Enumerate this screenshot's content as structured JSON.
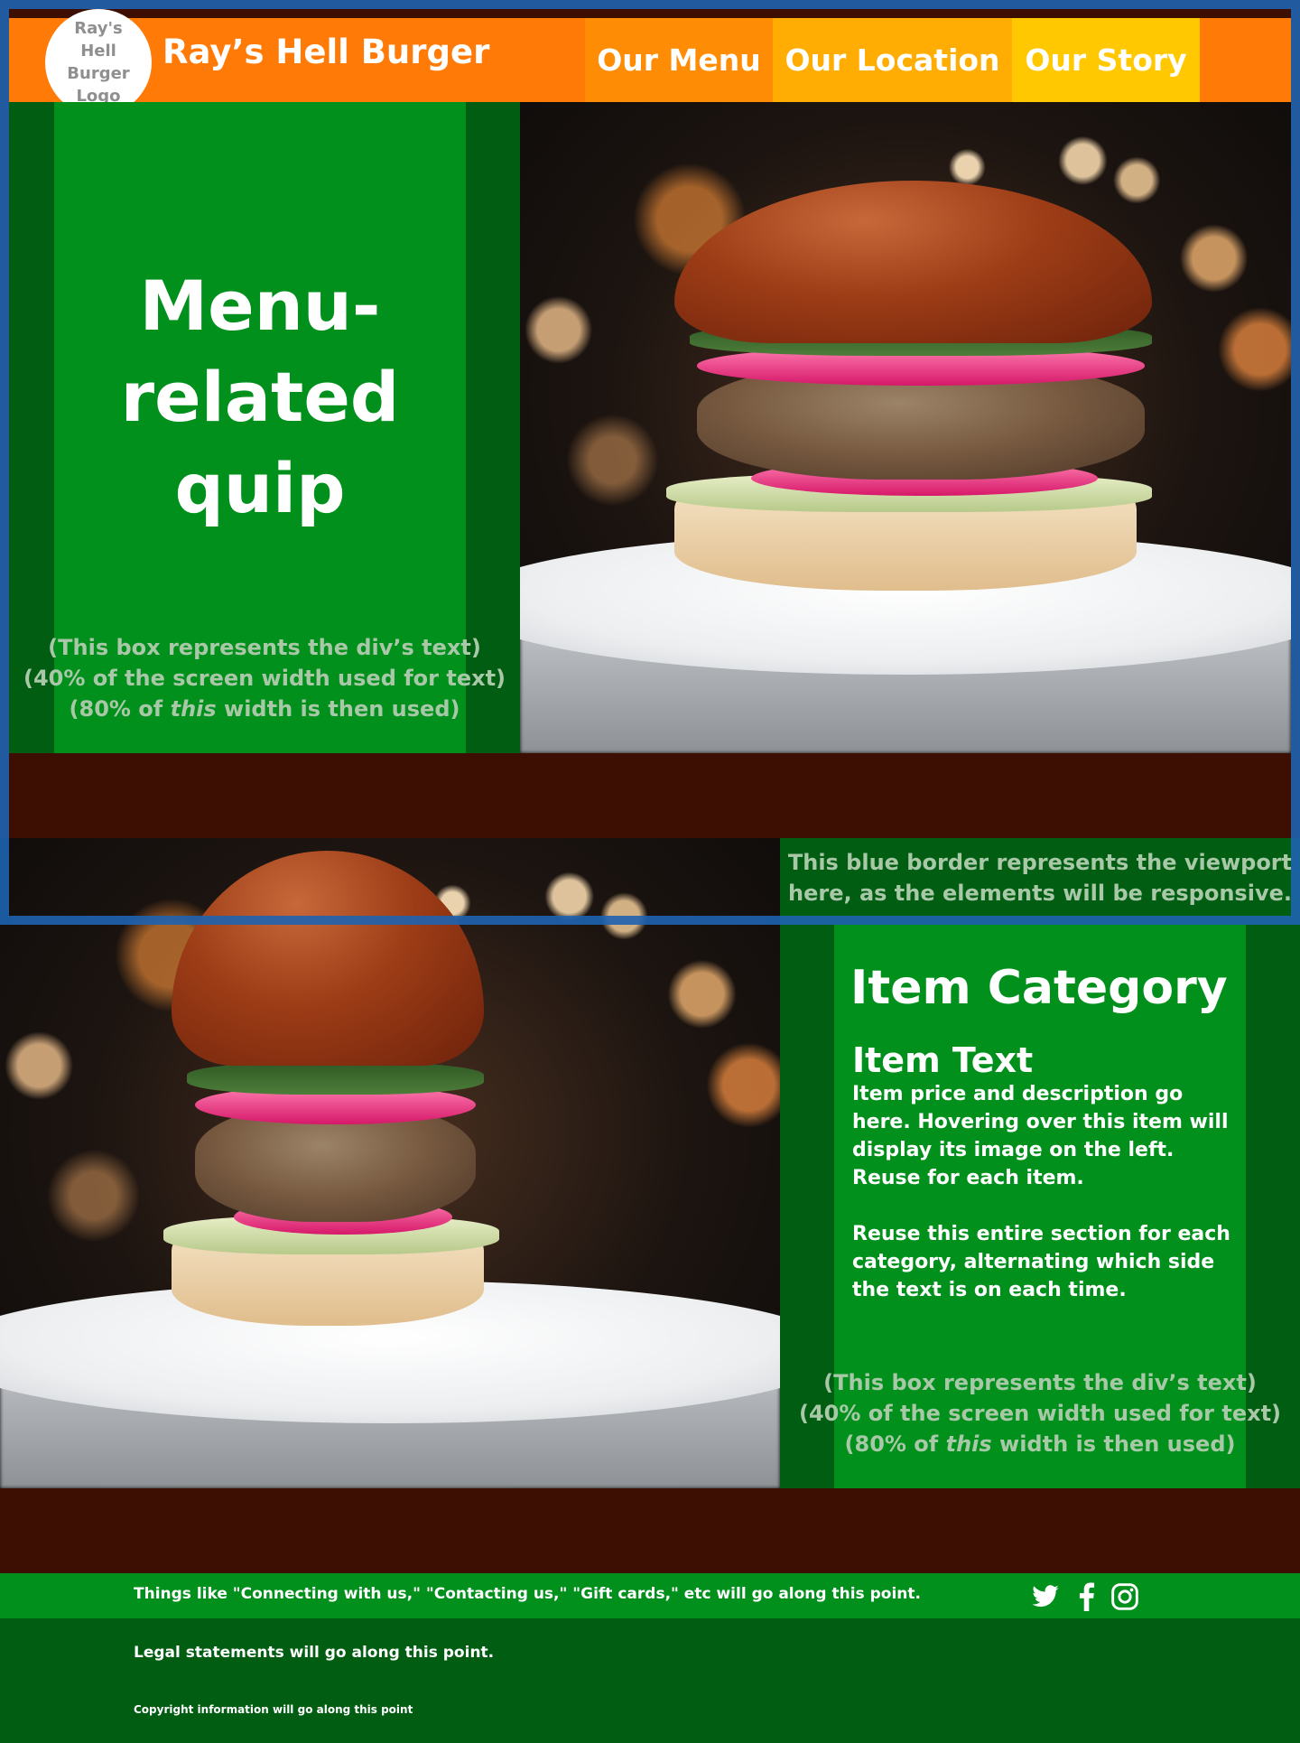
{
  "brand": {
    "logo_text": "Ray's Hell Burger Logo",
    "name": "Ray’s Hell Burger"
  },
  "nav": [
    {
      "label": "Our Menu",
      "color": "#ff8c05"
    },
    {
      "label": "Our Location",
      "color": "#ffad02"
    },
    {
      "label": "Our Story",
      "color": "#ffc800"
    }
  ],
  "hero": {
    "quip": "Menu-related quip",
    "note_line1": "(This box represents the div’s text)",
    "note_line2": "(40% of the screen width used for text)",
    "note_line3_pre": "(80% of ",
    "note_line3_em": "this",
    "note_line3_post": " width is then used)"
  },
  "viewport_note": {
    "line1": "This blue border represents the viewport",
    "line2": "here, as the elements will be responsive."
  },
  "category": {
    "title": "Item Category",
    "item_title": "Item Text",
    "item_desc": "Item price and description go here.  Hovering over this item will display its image on the left. Reuse for each item.",
    "reuse_note": "Reuse this entire section for each category, alternating which side the text is on each time.",
    "note_line1": "(This box represents the div’s text)",
    "note_line2": "(40% of the screen width used for text)",
    "note_line3_pre": "(80% of ",
    "note_line3_em": "this",
    "note_line3_post": " width is then used)"
  },
  "footer": {
    "connect": "Things like \"Connecting with us,\" \"Contacting us,\" \"Gift cards,\" etc will go along this point.",
    "legal": "Legal statements will go along this point.",
    "copyright": "Copyright information will go along this point",
    "social_icons": [
      "twitter-icon",
      "facebook-icon",
      "instagram-icon"
    ]
  },
  "colors": {
    "header_orange": "#ff7a07",
    "green": "#01901b",
    "dark_green": "#005d11",
    "maroon": "#3d0f02",
    "viewport_blue": "#1e63b0"
  }
}
